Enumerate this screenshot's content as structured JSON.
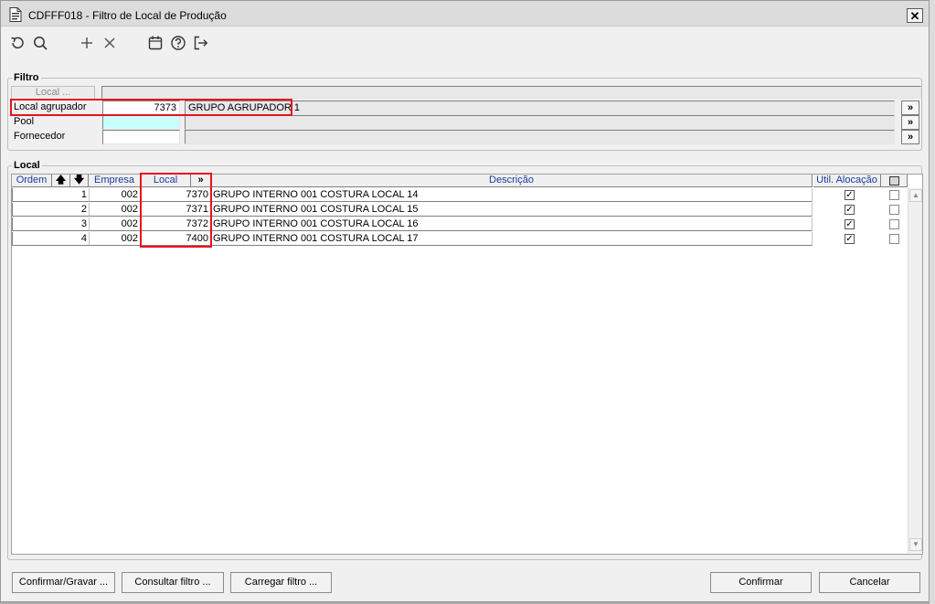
{
  "window": {
    "title": "CDFFF018 - Filtro de Local de Produção",
    "close_label": "✕"
  },
  "toolbar": {
    "icons": [
      "undo-icon",
      "search-icon",
      "add-icon",
      "delete-icon",
      "calendar-icon",
      "help-icon",
      "exit-icon"
    ]
  },
  "filtro": {
    "group_label": "Filtro",
    "local_button": "Local ...",
    "local_agrupador_label": "Local agrupador",
    "local_agrupador_value": "7373",
    "local_agrupador_desc": "GRUPO  AGRUPADOR 1",
    "pool_label": "Pool",
    "pool_value": "",
    "fornecedor_label": "Fornecedor",
    "fornecedor_value": "",
    "lookup_label": "»"
  },
  "local": {
    "group_label": "Local",
    "columns": {
      "ordem": "Ordem",
      "up": "🡅",
      "down": "🡇",
      "empresa": "Empresa",
      "local": "Local",
      "local_more": "»",
      "descricao": "Descrição",
      "util_alocacao": "Util. Alocação"
    },
    "rows": [
      {
        "ordem": "1",
        "empresa": "002",
        "local": "7370",
        "descricao": "GRUPO INTERNO 001 COSTURA LOCAL 14",
        "util": "✓"
      },
      {
        "ordem": "2",
        "empresa": "002",
        "local": "7371",
        "descricao": "GRUPO INTERNO 001 COSTURA LOCAL 15",
        "util": "✓"
      },
      {
        "ordem": "3",
        "empresa": "002",
        "local": "7372",
        "descricao": "GRUPO INTERNO 001 COSTURA LOCAL 16",
        "util": "✓"
      },
      {
        "ordem": "4",
        "empresa": "002",
        "local": "7400",
        "descricao": "GRUPO INTERNO 001 COSTURA LOCAL 17",
        "util": "✓"
      }
    ]
  },
  "buttons": {
    "confirmar_gravar": "Confirmar/Gravar ...",
    "consultar_filtro": "Consultar filtro ...",
    "carregar_filtro": "Carregar filtro ...",
    "confirmar": "Confirmar",
    "cancelar": "Cancelar"
  },
  "colors": {
    "highlight": "#e8121d",
    "header_text": "#1a3c9c",
    "pool_field": "#c8ffff"
  }
}
